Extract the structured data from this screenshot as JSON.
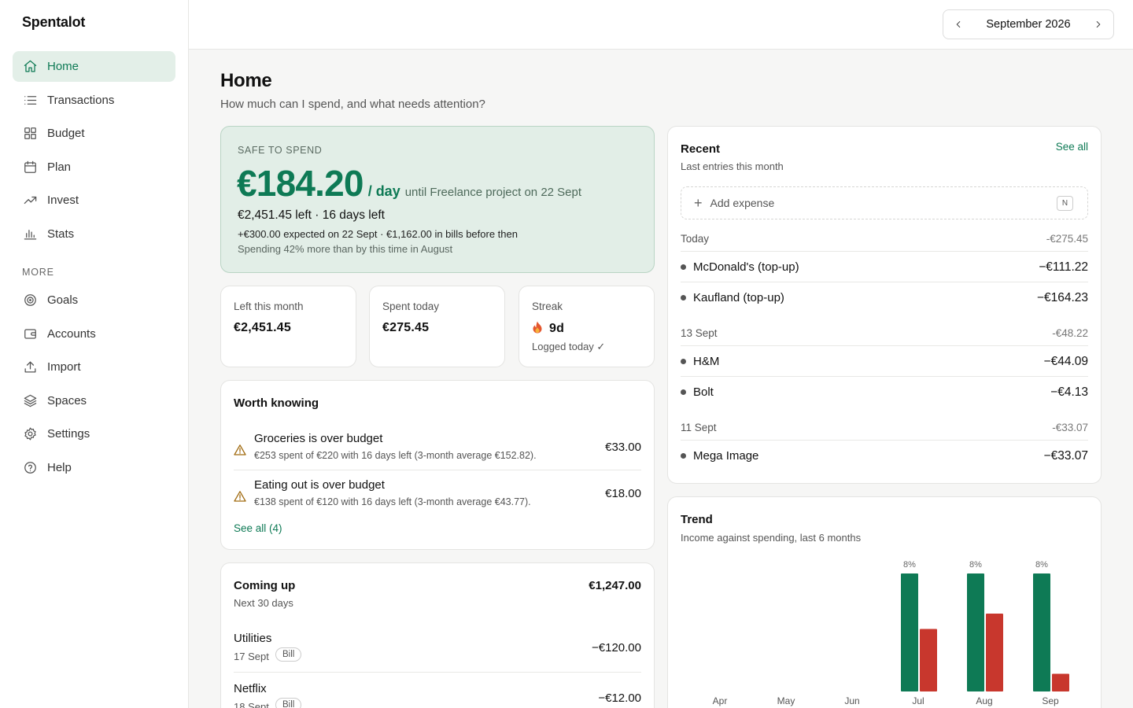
{
  "app": {
    "name": "Spentalot"
  },
  "sidebar": {
    "items": [
      {
        "label": "Home",
        "icon": "home-icon",
        "active": true
      },
      {
        "label": "Transactions",
        "icon": "list-icon"
      },
      {
        "label": "Budget",
        "icon": "grid-icon"
      },
      {
        "label": "Plan",
        "icon": "calendar-icon"
      },
      {
        "label": "Invest",
        "icon": "trending-up-icon"
      },
      {
        "label": "Stats",
        "icon": "bar-chart-icon"
      }
    ],
    "more_label": "MORE",
    "more_items": [
      {
        "label": "Goals",
        "icon": "target-icon"
      },
      {
        "label": "Accounts",
        "icon": "wallet-icon"
      },
      {
        "label": "Import",
        "icon": "upload-icon"
      },
      {
        "label": "Spaces",
        "icon": "layers-icon"
      },
      {
        "label": "Settings",
        "icon": "gear-icon"
      },
      {
        "label": "Help",
        "icon": "help-circle-icon"
      }
    ]
  },
  "topbar": {
    "month": "September 2026"
  },
  "page": {
    "title": "Home",
    "subtitle": "How much can I spend, and what needs attention?"
  },
  "safe_to_spend": {
    "eyebrow": "SAFE TO SPEND",
    "amount": "€184.20",
    "per_day": "/ day",
    "until": "until Freelance project on 22 Sept",
    "left_line": "€2,451.45 left · 16 days left",
    "expected": "+€300.00 expected on 22 Sept · €1,162.00 in bills before then",
    "compare": "Spending 42% more than by this time in August",
    "accent": "#0e7a55"
  },
  "stats": {
    "left": {
      "label": "Left this month",
      "value": "€2,451.45"
    },
    "spent": {
      "label": "Spent today",
      "value": "€275.45"
    },
    "streak": {
      "label": "Streak",
      "value": "9d",
      "sub": "Logged today ✓"
    }
  },
  "worth_knowing": {
    "title": "Worth knowing",
    "alerts": [
      {
        "title": "Groceries is over budget",
        "detail": "€253 spent of €220 with 16 days left (3-month average €152.82).",
        "amount": "€33.00"
      },
      {
        "title": "Eating out is over budget",
        "detail": "€138 spent of €120 with 16 days left (3-month average €43.77).",
        "amount": "€18.00"
      }
    ],
    "see_all": "See all (4)"
  },
  "coming_up": {
    "title": "Coming up",
    "total": "€1,247.00",
    "subtitle": "Next 30 days",
    "bills": [
      {
        "name": "Utilities",
        "date": "17 Sept",
        "tag": "Bill",
        "amount": "−€120.00"
      },
      {
        "name": "Netflix",
        "date": "18 Sept",
        "tag": "Bill",
        "amount": "−€12.00"
      }
    ]
  },
  "recent": {
    "title": "Recent",
    "see_all": "See all",
    "subtitle": "Last entries this month",
    "add_placeholder": "Add expense",
    "shortcut": "N",
    "groups": [
      {
        "label": "Today",
        "total": "-€275.45",
        "items": [
          {
            "merchant": "McDonald's (top-up)",
            "amount": "−€111.22"
          },
          {
            "merchant": "Kaufland (top-up)",
            "amount": "−€164.23"
          }
        ]
      },
      {
        "label": "13 Sept",
        "total": "-€48.22",
        "items": [
          {
            "merchant": "H&M",
            "amount": "−€44.09"
          },
          {
            "merchant": "Bolt",
            "amount": "−€4.13"
          }
        ]
      },
      {
        "label": "11 Sept",
        "total": "-€33.07",
        "items": [
          {
            "merchant": "Mega Image",
            "amount": "−€33.07"
          }
        ]
      }
    ]
  },
  "trend": {
    "title": "Trend",
    "subtitle": "Income against spending, last 6 months"
  },
  "chart_data": {
    "type": "bar",
    "categories": [
      "Apr",
      "May",
      "Jun",
      "Jul",
      "Aug",
      "Sep"
    ],
    "series": [
      {
        "values": [
          0,
          0,
          0,
          100,
          100,
          100
        ],
        "color": "#0e7a55"
      },
      {
        "values": [
          0,
          0,
          0,
          53,
          66,
          15
        ],
        "color": "#c8372d"
      }
    ],
    "bar_labels": [
      "",
      "",
      "",
      "8%",
      "8%",
      "8%"
    ],
    "ylim": [
      0,
      100
    ],
    "grid": false,
    "legend": "none"
  }
}
